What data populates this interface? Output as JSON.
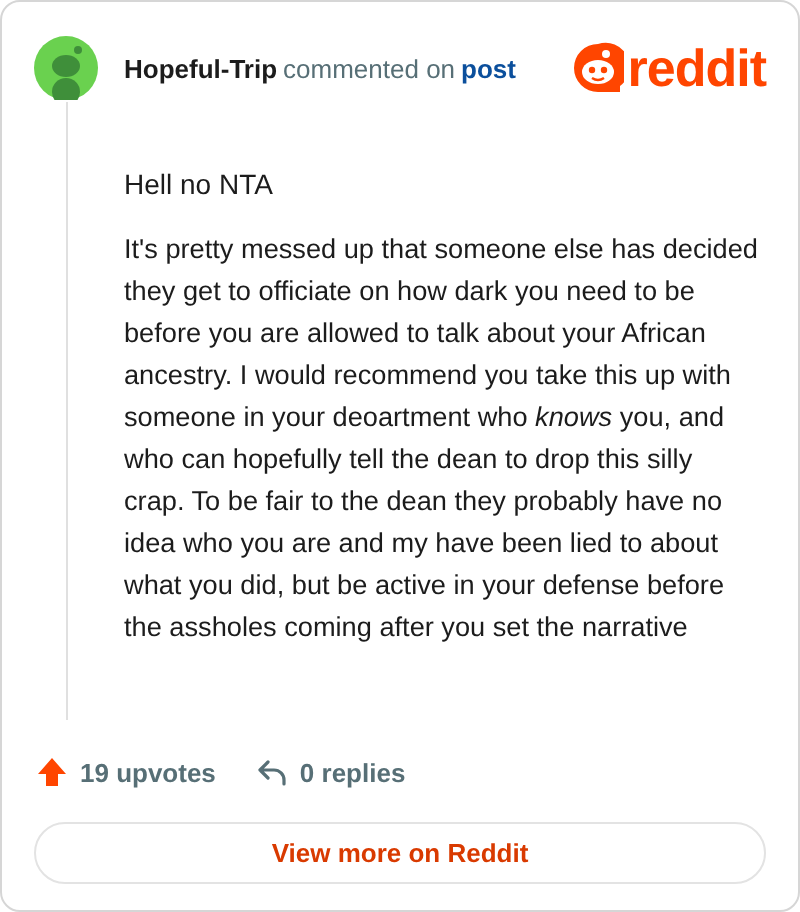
{
  "comment": {
    "author": "Hopeful-Trip",
    "action": "commented on",
    "link": "post",
    "logo": "reddit",
    "title": "Hell no NTA",
    "body": "It's pretty messed up that someone else has decided they get to officiate on how dark you need to be before you are allowed to talk about your African ancestry. I would recommend you take this up with someone in your deoartment who *knows* you, and who can hopefully tell the dean to drop this silly crap. To be fair to the dean they probably have no idea who you are and my have been lied to about what you did, but be active in your defense before the assholes coming after you set the narrative"
  },
  "footer": {
    "upvotes": "19 upvotes",
    "replies": "0 replies",
    "button": "View more on Reddit"
  }
}
